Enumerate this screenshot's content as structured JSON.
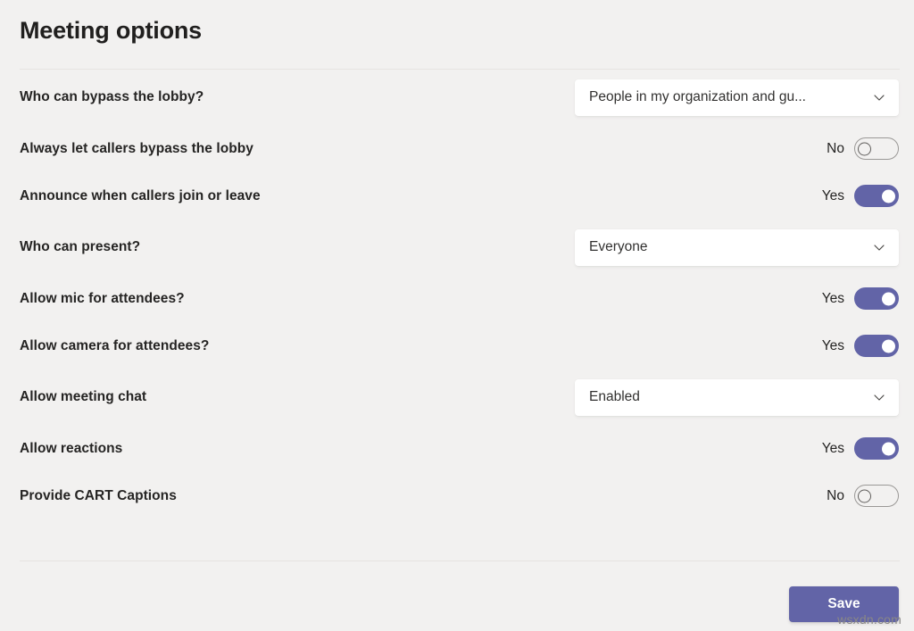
{
  "header": {
    "title": "Meeting options"
  },
  "options": [
    {
      "label": "Who can bypass the lobby?",
      "control": "dropdown",
      "value": "People in my organization and gu...",
      "icon": "chevron-down-icon",
      "name": "who-can-bypass-lobby"
    },
    {
      "label": "Always let callers bypass the lobby",
      "control": "toggle",
      "state": "No",
      "on": false,
      "name": "always-let-callers-bypass-lobby"
    },
    {
      "label": "Announce when callers join or leave",
      "control": "toggle",
      "state": "Yes",
      "on": true,
      "name": "announce-when-callers-join-or-leave"
    },
    {
      "label": "Who can present?",
      "control": "dropdown",
      "value": "Everyone",
      "icon": "chevron-down-icon",
      "name": "who-can-present"
    },
    {
      "label": "Allow mic for attendees?",
      "control": "toggle",
      "state": "Yes",
      "on": true,
      "name": "allow-mic-for-attendees"
    },
    {
      "label": "Allow camera for attendees?",
      "control": "toggle",
      "state": "Yes",
      "on": true,
      "name": "allow-camera-for-attendees"
    },
    {
      "label": "Allow meeting chat",
      "control": "dropdown",
      "value": "Enabled",
      "icon": "chevron-down-icon",
      "name": "allow-meeting-chat"
    },
    {
      "label": "Allow reactions",
      "control": "toggle",
      "state": "Yes",
      "on": true,
      "name": "allow-reactions"
    },
    {
      "label": "Provide CART Captions",
      "control": "toggle",
      "state": "No",
      "on": false,
      "name": "provide-cart-captions"
    }
  ],
  "footer": {
    "save_label": "Save"
  },
  "watermark": {
    "text": "wsxdn.com"
  },
  "colors": {
    "accent": "#6264a7",
    "background": "#f2f1f0",
    "field_background": "#ffffff",
    "text": "#252423",
    "divider": "#e6e3e1"
  }
}
